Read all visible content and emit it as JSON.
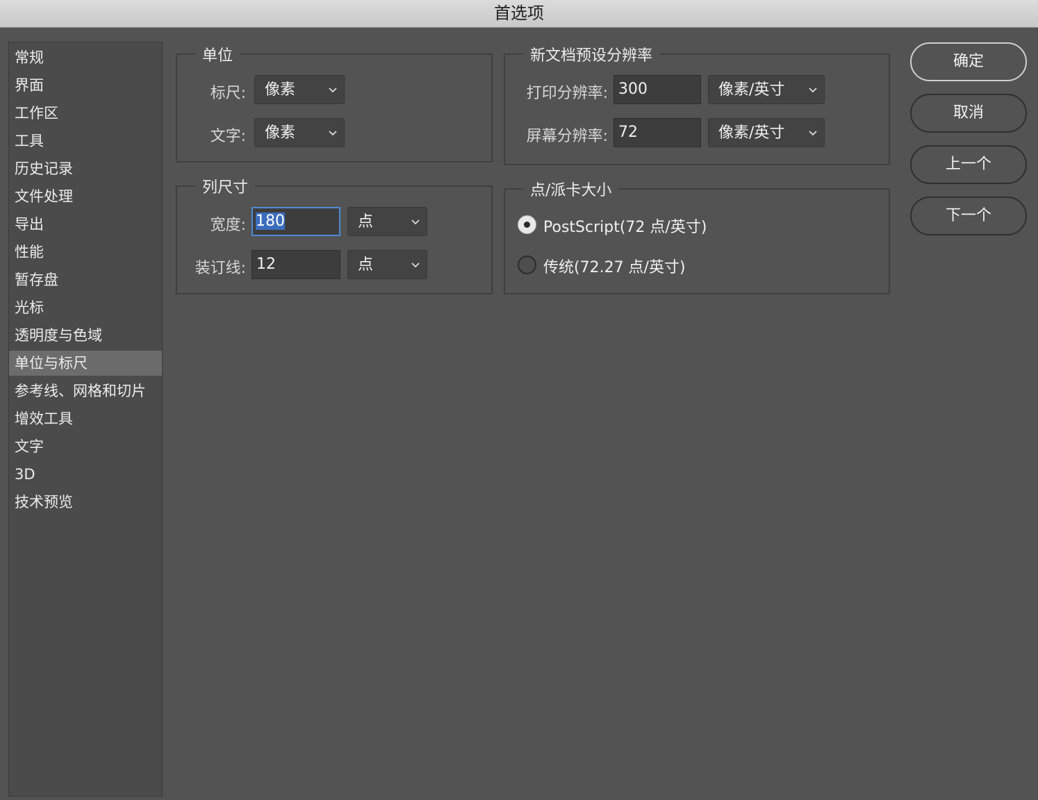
{
  "window": {
    "title": "首选项"
  },
  "sidebar": {
    "items": [
      {
        "label": "常规"
      },
      {
        "label": "界面"
      },
      {
        "label": "工作区"
      },
      {
        "label": "工具"
      },
      {
        "label": "历史记录"
      },
      {
        "label": "文件处理"
      },
      {
        "label": "导出"
      },
      {
        "label": "性能"
      },
      {
        "label": "暂存盘"
      },
      {
        "label": "光标"
      },
      {
        "label": "透明度与色域"
      },
      {
        "label": "单位与标尺"
      },
      {
        "label": "参考线、网格和切片"
      },
      {
        "label": "增效工具"
      },
      {
        "label": "文字"
      },
      {
        "label": "3D"
      },
      {
        "label": "技术预览"
      }
    ],
    "selected": "单位与标尺"
  },
  "units": {
    "legend": "单位",
    "ruler_label": "标尺:",
    "ruler_value": "像素",
    "type_label": "文字:",
    "type_value": "像素"
  },
  "column_size": {
    "legend": "列尺寸",
    "width_label": "宽度:",
    "width_value": "180",
    "width_unit": "点",
    "gutter_label": "装订线:",
    "gutter_value": "12",
    "gutter_unit": "点"
  },
  "resolution": {
    "legend": "新文档预设分辨率",
    "print_label": "打印分辨率:",
    "print_value": "300",
    "print_unit": "像素/英寸",
    "screen_label": "屏幕分辨率:",
    "screen_value": "72",
    "screen_unit": "像素/英寸"
  },
  "point_size": {
    "legend": "点/派卡大小",
    "options": [
      {
        "label": "PostScript(72 点/英寸)",
        "selected": true
      },
      {
        "label": "传统(72.27 点/英寸)",
        "selected": false
      }
    ]
  },
  "buttons": {
    "ok": "确定",
    "cancel": "取消",
    "prev": "上一个",
    "next": "下一个"
  }
}
